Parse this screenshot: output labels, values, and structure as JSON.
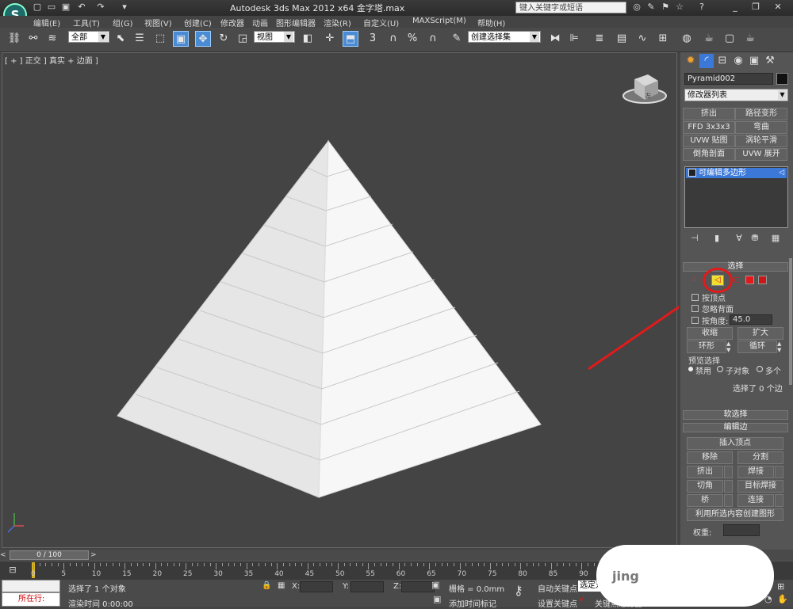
{
  "window": {
    "title": "Autodesk 3ds Max  2012 x64      金字塔.max",
    "search_placeholder": "键入关键字或短语"
  },
  "menu": [
    "编辑(E)",
    "工具(T)",
    "组(G)",
    "视图(V)",
    "创建(C)",
    "修改器",
    "动画",
    "图形编辑器",
    "渲染(R)",
    "自定义(U)",
    "MAXScript(M)",
    "帮助(H)"
  ],
  "toolbar": {
    "selection_filter": "全部",
    "coordinate_system": "视图",
    "named_selection": "创建选择集"
  },
  "viewport": {
    "label": "[ + ] 正交 ] 真实 + 边面 ]",
    "viewcube_label": "左"
  },
  "command_panel": {
    "object_name": "Pyramid002",
    "modifier_list": "修改器列表",
    "modifier_buttons": [
      "挤出",
      "路径变形",
      "FFD 3x3x3",
      "弯曲",
      "UVW 贴图",
      "涡轮平滑",
      "倒角剖面",
      "UVW 展开"
    ],
    "stack_item": "可编辑多边形",
    "selection": {
      "title": "选择",
      "by_vertex": "按顶点",
      "ignore_backfacing": "忽略背面",
      "by_angle": "按角度:",
      "angle_value": "45.0",
      "shrink": "收缩",
      "grow": "扩大",
      "ring": "环形",
      "loop": "循环",
      "preview_title": "预览选择",
      "preview_options": [
        "禁用",
        "子对象",
        "多个"
      ],
      "status": "选择了 0 个边"
    },
    "soft_selection": "软选择",
    "edit_edges": {
      "title": "编辑边",
      "insert_vertex": "插入顶点",
      "remove": "移除",
      "split": "分割",
      "extrude": "挤出",
      "weld": "焊接",
      "chamfer": "切角",
      "target_weld": "目标焊接",
      "bridge": "桥",
      "connect": "连接",
      "create_shape": "利用所选内容创建图形",
      "weight": "权重:"
    }
  },
  "timeline": {
    "frame": "0 / 100",
    "ticks": [
      "0",
      "5",
      "10",
      "15",
      "20",
      "25",
      "30",
      "35",
      "40",
      "45",
      "50",
      "55",
      "60",
      "65",
      "70",
      "75",
      "80",
      "85",
      "90"
    ]
  },
  "status": {
    "location": "所在行:",
    "selected": "选择了 1 个对象",
    "render_time": "渲染时间  0:00:00",
    "x": "X:",
    "y": "Y:",
    "z": "Z:",
    "grid": "栅格 = 0.0mm",
    "add_time_tag": "添加时间标记",
    "auto_key": "自动关键点",
    "selected_obj": "选定对象",
    "set_key": "设置关键点",
    "key_filter": "关键点过滤器...",
    "watermark": "jing"
  },
  "colors": {
    "highlight_circle": "#e21a1a",
    "edge_icon_bg": "#f0e030",
    "stack_selected": "#3b78d8"
  }
}
